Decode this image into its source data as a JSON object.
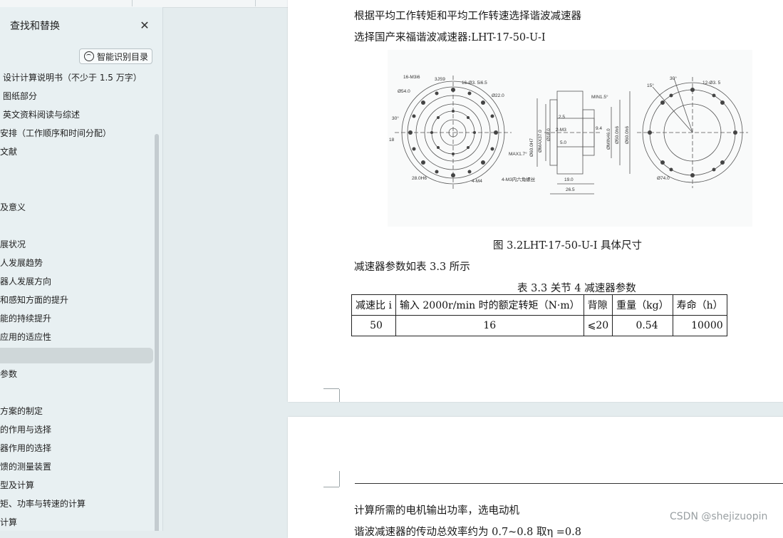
{
  "panel": {
    "title": "查找和替换",
    "smart_button": "智能识别目录",
    "toc": [
      {
        "label": "设计计算说明书（不少于 1.5 万字）"
      },
      {
        "label": "图纸部分"
      },
      {
        "label": "英文资料阅读与综述"
      },
      {
        "label": "安排（工作顺序和时间分配）"
      },
      {
        "label": "文献"
      },
      {
        "label": ""
      },
      {
        "label": ""
      },
      {
        "label": "及意义"
      },
      {
        "label": ""
      },
      {
        "label": "展状况"
      },
      {
        "label": "人发展趋势"
      },
      {
        "label": "器人发展方向"
      },
      {
        "label": "和感知方面的提升"
      },
      {
        "label": "能的持续提升"
      },
      {
        "label": "应用的适应性"
      },
      {
        "label": ""
      },
      {
        "label": "参数"
      },
      {
        "label": ""
      },
      {
        "label": "方案的制定"
      },
      {
        "label": "的作用与选择"
      },
      {
        "label": "器作用的选择"
      },
      {
        "label": "馈的测量装置"
      },
      {
        "label": "型及计算"
      },
      {
        "label": "矩、功率与转速的计算"
      },
      {
        "label": "计算"
      }
    ]
  },
  "doc": {
    "line1": "根据平均工作转矩和平均工作转速选择谐波减速器",
    "line2": "选择国产来福谐波减速器:LHT-17-50-U-I",
    "figure_caption": "图 3.2LHT-17-50-U-I 具体尺寸",
    "param_intro": "减速器参数如表 3.3 所示",
    "table_caption": "表 3.3 关节 4 减速器参数",
    "table": {
      "headers": [
        "减速比 i",
        "输入 2000r/min 时的额定转矩（N·m）",
        "背隙",
        "重量（kg）",
        "寿命（h）"
      ],
      "row": [
        "50",
        "16",
        "⩽20",
        "0.54",
        "10000"
      ]
    },
    "page2_line1": "计算所需的电机输出功率，选电动机",
    "page2_line2": "谐波减速器的传动总效率约为 0.7~0.8 取η =0.8"
  },
  "figure_labels": {
    "a1": "16-M3i6",
    "a2": "3JS9",
    "a3": "16-Ø3. 5i6.5",
    "a4": "Ø54.0",
    "a5": "Ø22.0",
    "a6": "30°",
    "a7": "18",
    "a8": "28.0H6",
    "a9": "4-M4",
    "b1": "MIN1.5°",
    "b2": "2.5",
    "b3": "2-M3",
    "b4": "5.0",
    "b5": "9.4",
    "b6": "Ø60.0H7",
    "b7": "ØMAX37.0",
    "b8": "Ø18.0",
    "b9": "ØMIN46.0",
    "b10": "Ø50.0h6",
    "b11": "Ø60.0h6",
    "b12": "MAX1.7°",
    "b13": "19.0",
    "b14": "26.5",
    "b15": "4-M3内六角螺丝",
    "c1": "15°",
    "c2": "30°",
    "c3": "12-Ø3. 5",
    "c4": "Ø74.0"
  },
  "watermark": "CSDN @shejizuopin"
}
